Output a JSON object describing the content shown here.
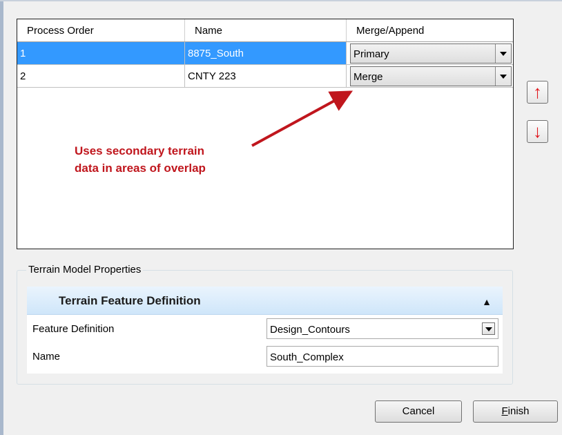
{
  "grid": {
    "columns": [
      "Process Order",
      "Name",
      "Merge/Append"
    ],
    "rows": [
      {
        "order": "1",
        "name": "8875_South",
        "mode": "Primary",
        "selected": true
      },
      {
        "order": "2",
        "name": "CNTY 223",
        "mode": "Merge",
        "selected": false
      }
    ]
  },
  "annotation": {
    "line1": "Uses secondary terrain",
    "line2": "data in areas of overlap",
    "color": "#c0161d"
  },
  "move_buttons": {
    "up_glyph": "↑",
    "down_glyph": "↓",
    "up_icon": "arrow-up-icon",
    "down_icon": "arrow-down-icon",
    "color": "#e0141a"
  },
  "properties": {
    "group_label": "Terrain Model Properties",
    "section_title": "Terrain Feature Definition",
    "collapse_icon": "chevron-up-icon",
    "fields": [
      {
        "label": "Feature Definition",
        "value": "Design_Contours",
        "type": "dropdown"
      },
      {
        "label": "Name",
        "value": "South_Complex",
        "type": "text"
      }
    ]
  },
  "footer": {
    "cancel_label": "Cancel",
    "finish_mnemonic": "F",
    "finish_rest": "inish"
  },
  "colors": {
    "selection": "#3399ff",
    "section_header": "#cfe6fa"
  }
}
